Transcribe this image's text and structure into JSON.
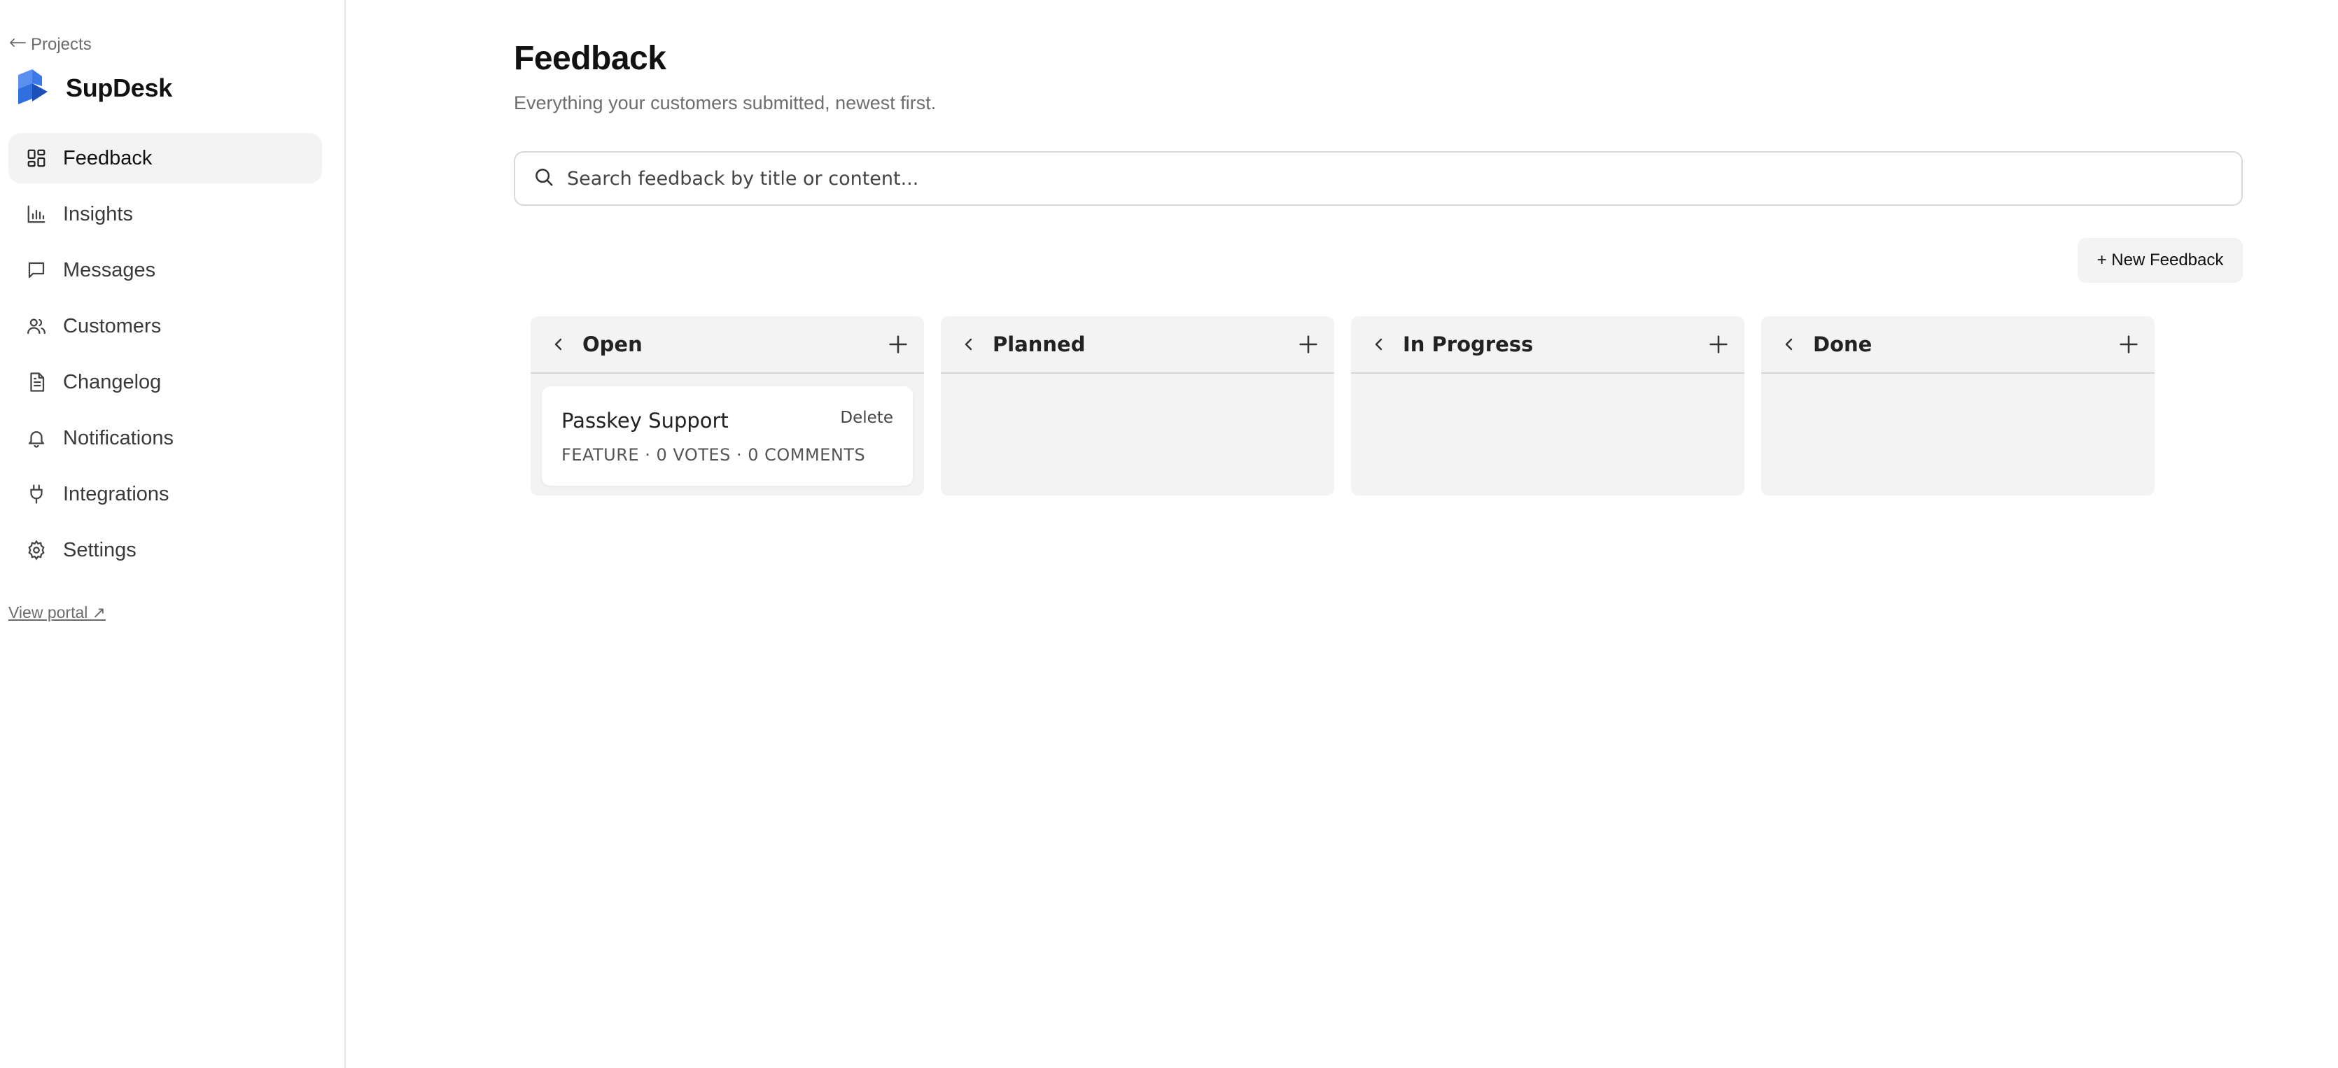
{
  "sidebar": {
    "back_label": "Projects",
    "brand_name": "SupDesk",
    "items": [
      {
        "label": "Feedback",
        "icon": "dashboard-icon",
        "active": true
      },
      {
        "label": "Insights",
        "icon": "bar-chart-icon"
      },
      {
        "label": "Messages",
        "icon": "message-icon"
      },
      {
        "label": "Customers",
        "icon": "users-icon"
      },
      {
        "label": "Changelog",
        "icon": "document-icon"
      },
      {
        "label": "Notifications",
        "icon": "bell-icon"
      },
      {
        "label": "Integrations",
        "icon": "plug-icon"
      },
      {
        "label": "Settings",
        "icon": "gear-icon"
      }
    ],
    "portal_link": "View portal ↗"
  },
  "header": {
    "title": "Feedback",
    "subtitle": "Everything your customers submitted, newest first."
  },
  "search": {
    "placeholder": "Search feedback by title or content..."
  },
  "toolbar": {
    "new_label": "+ New Feedback"
  },
  "board": {
    "columns": [
      {
        "title": "Open",
        "cards": [
          {
            "title": "Passkey Support",
            "meta": "FEATURE · 0 VOTES · 0 COMMENTS",
            "delete_label": "Delete"
          }
        ]
      },
      {
        "title": "Planned",
        "cards": []
      },
      {
        "title": "In Progress",
        "cards": []
      },
      {
        "title": "Done",
        "cards": []
      }
    ]
  },
  "colors": {
    "brand_blue": "#2f6fe0",
    "brand_blue_dark": "#1d4fb8",
    "active_bg": "#f3f3f3",
    "column_bg": "#f3f3f3"
  }
}
